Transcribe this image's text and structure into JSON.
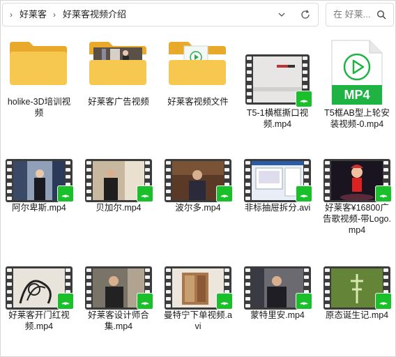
{
  "address": {
    "crumbs": [
      "好莱客",
      "好莱客视频介绍"
    ]
  },
  "search": {
    "placeholder": "在 好莱..."
  },
  "items": [
    {
      "label": "holike-3D培训视频",
      "kind": "folder"
    },
    {
      "label": "好莱客广告视频",
      "kind": "folder-preview"
    },
    {
      "label": "好莱客视频文件",
      "kind": "folder-doc"
    },
    {
      "label": "T5-1横框撕口视频.mp4",
      "kind": "video"
    },
    {
      "label": "T5框AB型上轮安装视频-0.mp4",
      "kind": "mp4-file",
      "badge_text": "MP4"
    },
    {
      "label": "阿尔卑斯.mp4",
      "kind": "video"
    },
    {
      "label": "贝加尔.mp4",
      "kind": "video"
    },
    {
      "label": "波尔多.mp4",
      "kind": "video"
    },
    {
      "label": "非标抽屉拆分.avi",
      "kind": "video"
    },
    {
      "label": "好莱客¥16800广告歌视频-带Logo.mp4",
      "kind": "video"
    },
    {
      "label": "好莱客开门红视频.mp4",
      "kind": "video"
    },
    {
      "label": "好莱客设计师合集.mp4",
      "kind": "video"
    },
    {
      "label": "曼特宁下单视频.avi",
      "kind": "video"
    },
    {
      "label": "蒙特里安.mp4",
      "kind": "video"
    },
    {
      "label": "原态诞生记.mp4",
      "kind": "video"
    }
  ],
  "colors": {
    "folder": "#f5c24a",
    "folder_dark": "#e9a92a",
    "badge": "#19c02a",
    "mp4_green": "#1fb344"
  }
}
